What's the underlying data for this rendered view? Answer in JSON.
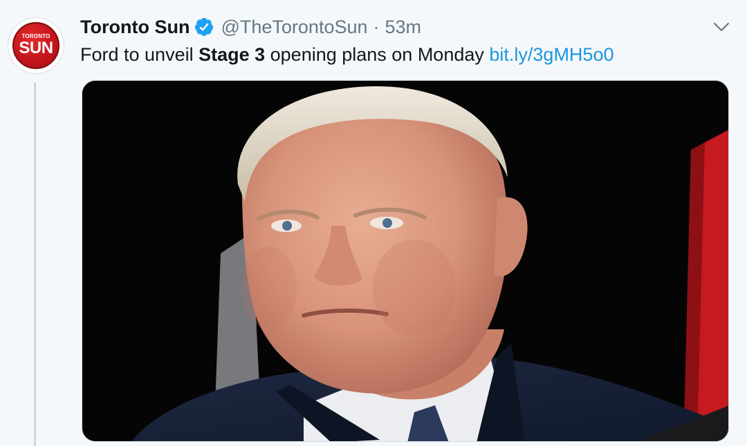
{
  "tweet": {
    "display_name": "Toronto Sun",
    "handle": "@TheTorontoSun",
    "separator": "·",
    "time": "53m",
    "text_before": "Ford to unveil ",
    "text_bold": "Stage 3",
    "text_after": " opening plans on Monday ",
    "link": "bit.ly/3gMH5o0"
  },
  "avatar": {
    "small_text": "TORONTO",
    "big_text": "SUN",
    "color": "#c4161c"
  },
  "colors": {
    "link": "#1b95e0",
    "verified": "#1da1f2",
    "secondary_text": "#657786"
  },
  "media": {
    "alt": "photo of a man in a dark suit",
    "icon": "photo-image"
  },
  "icons": {
    "verified": "verified-badge-icon",
    "more": "chevron-down-icon"
  }
}
